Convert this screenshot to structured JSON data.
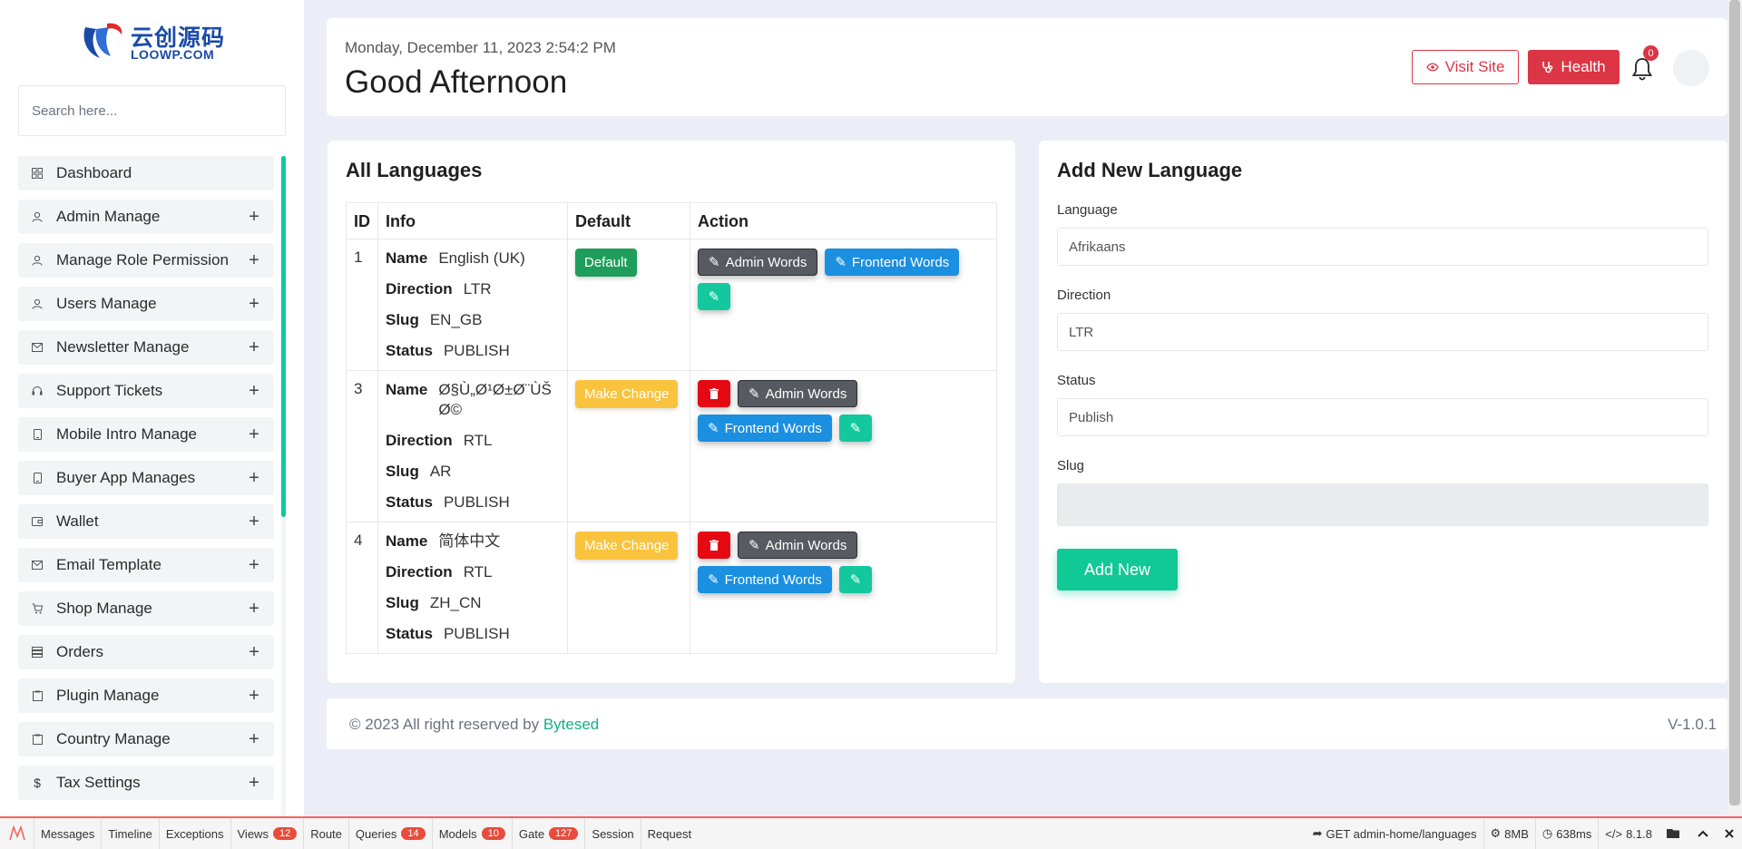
{
  "brand": {
    "logo_cn": "云创源码",
    "logo_en": "LOOWP.COM",
    "accent": "#10c8a0"
  },
  "sidebar": {
    "search_placeholder": "Search here...",
    "items": [
      {
        "label": "Dashboard",
        "icon": "grid-icon"
      },
      {
        "label": "Admin Manage",
        "icon": "user-icon"
      },
      {
        "label": "Manage Role Permission",
        "icon": "user-icon"
      },
      {
        "label": "Users Manage",
        "icon": "user-icon"
      },
      {
        "label": "Newsletter Manage",
        "icon": "envelope-icon"
      },
      {
        "label": "Support Tickets",
        "icon": "headset-icon"
      },
      {
        "label": "Mobile Intro Manage",
        "icon": "mobile-icon"
      },
      {
        "label": "Buyer App Manages",
        "icon": "mobile-icon"
      },
      {
        "label": "Wallet",
        "icon": "wallet-icon"
      },
      {
        "label": "Email Template",
        "icon": "envelope-icon"
      },
      {
        "label": "Shop Manage",
        "icon": "cart-icon"
      },
      {
        "label": "Orders",
        "icon": "list-icon"
      },
      {
        "label": "Plugin Manage",
        "icon": "clipboard-icon"
      },
      {
        "label": "Country Manage",
        "icon": "clipboard-icon"
      },
      {
        "label": "Tax Settings",
        "icon": "dollar-icon"
      }
    ]
  },
  "header": {
    "date": "Monday, December 11, 2023 2:54:2 PM",
    "greeting": "Good Afternoon",
    "visit_site": "Visit Site",
    "health": "Health",
    "notification_count": "0"
  },
  "languages": {
    "title": "All Languages",
    "columns": [
      "ID",
      "Info",
      "Default",
      "Action"
    ],
    "field_labels": {
      "name": "Name",
      "direction": "Direction",
      "slug": "Slug",
      "status": "Status"
    },
    "rows": [
      {
        "id": "1",
        "name": "English (UK)",
        "direction": "LTR",
        "slug": "EN_GB",
        "status": "PUBLISH",
        "default_label": "Default"
      },
      {
        "id": "3",
        "name": "Ø§Ù„Ø¹Ø±Ø¨ÙŠØ©",
        "direction": "RTL",
        "slug": "AR",
        "status": "PUBLISH",
        "default_label": "Make Change"
      },
      {
        "id": "4",
        "name": "简体中文",
        "direction": "RTL",
        "slug": "ZH_CN",
        "status": "PUBLISH",
        "default_label": "Make Change"
      }
    ],
    "admin_words": "Admin Words",
    "frontend_words": "Frontend Words"
  },
  "form": {
    "title": "Add New Language",
    "language_label": "Language",
    "language_value": "Afrikaans",
    "direction_label": "Direction",
    "direction_value": "LTR",
    "status_label": "Status",
    "status_value": "Publish",
    "slug_label": "Slug",
    "submit": "Add New"
  },
  "footer": {
    "copyright": "© 2023 All right reserved by",
    "company": "Bytesed",
    "version": "V-1.0.1"
  },
  "debugbar": {
    "tabs": [
      {
        "label": "Messages"
      },
      {
        "label": "Timeline"
      },
      {
        "label": "Exceptions"
      },
      {
        "label": "Views",
        "badge": "12"
      },
      {
        "label": "Route"
      },
      {
        "label": "Queries",
        "badge": "14"
      },
      {
        "label": "Models",
        "badge": "10"
      },
      {
        "label": "Gate",
        "badge": "127"
      },
      {
        "label": "Session"
      },
      {
        "label": "Request"
      }
    ],
    "route": "GET admin-home/languages",
    "memory": "8MB",
    "time": "638ms",
    "php": "8.1.8"
  }
}
